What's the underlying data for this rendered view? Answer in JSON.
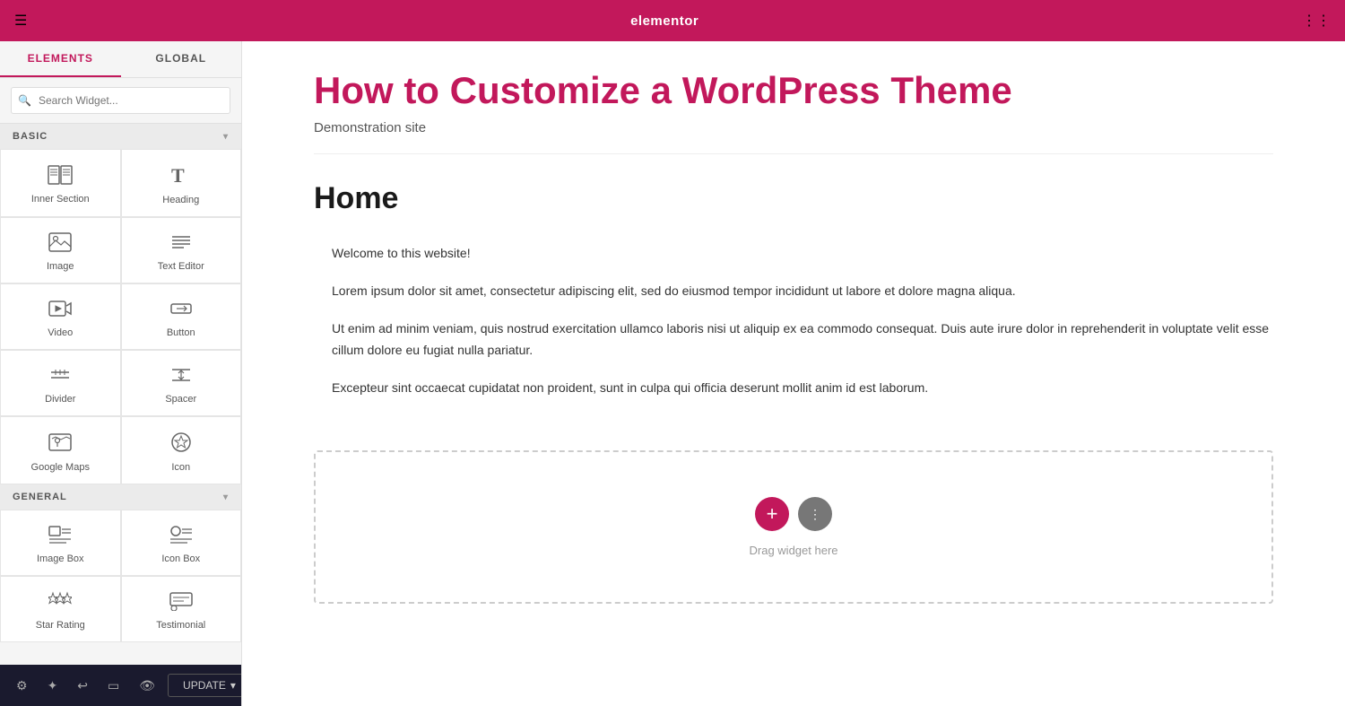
{
  "topBar": {
    "logo": "elementor",
    "hamburger": "☰",
    "grid": "⋮⋮"
  },
  "sidebar": {
    "tabs": [
      {
        "label": "ELEMENTS",
        "active": true
      },
      {
        "label": "GLOBAL",
        "active": false
      }
    ],
    "search": {
      "placeholder": "Search Widget..."
    },
    "sections": [
      {
        "label": "BASIC",
        "id": "basic",
        "widgets": [
          {
            "icon": "inner-section",
            "label": "Inner Section"
          },
          {
            "icon": "heading",
            "label": "Heading"
          },
          {
            "icon": "image",
            "label": "Image"
          },
          {
            "icon": "text-editor",
            "label": "Text Editor"
          },
          {
            "icon": "video",
            "label": "Video"
          },
          {
            "icon": "button",
            "label": "Button"
          },
          {
            "icon": "divider",
            "label": "Divider"
          },
          {
            "icon": "spacer",
            "label": "Spacer"
          },
          {
            "icon": "google-maps",
            "label": "Google Maps"
          },
          {
            "icon": "icon",
            "label": "Icon"
          }
        ]
      },
      {
        "label": "GENERAL",
        "id": "general",
        "widgets": [
          {
            "icon": "image-box",
            "label": "Image Box"
          },
          {
            "icon": "icon-box",
            "label": "Icon Box"
          },
          {
            "icon": "star-rating",
            "label": "Star Rating"
          },
          {
            "icon": "testimonial",
            "label": "Testimonial"
          }
        ]
      }
    ],
    "footer": {
      "icons": [
        "⚙",
        "✦",
        "↩",
        "▭",
        "👁"
      ],
      "updateLabel": "UPDATE",
      "updateArrow": "▾"
    }
  },
  "canvas": {
    "siteTitle": "How to Customize a WordPress Theme",
    "siteSubtitle": "Demonstration site",
    "pageTitle": "Home",
    "paragraphs": [
      "Welcome to this website!",
      "Lorem ipsum dolor sit amet, consectetur adipiscing elit, sed do eiusmod tempor incididunt ut labore et dolore magna aliqua.",
      "Ut enim ad minim veniam, quis nostrud exercitation ullamco laboris nisi ut aliquip ex ea commodo consequat. Duis aute irure dolor in reprehenderit in voluptate velit esse cillum dolore eu fugiat nulla pariatur.",
      "Excepteur sint occaecat cupidatat non proident, sunt in culpa qui officia deserunt mollit anim id est laborum."
    ],
    "dropZone": {
      "label": "Drag widget here",
      "addBtn": "+",
      "handleBtn": "⋮"
    }
  }
}
